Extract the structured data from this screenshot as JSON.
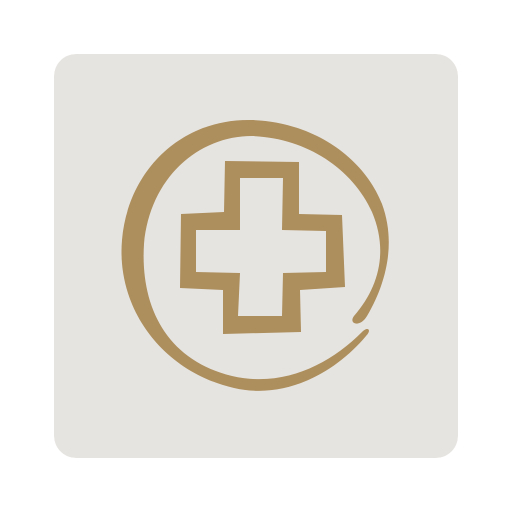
{
  "icon": {
    "name": "medical-cross-app-icon",
    "motif": "circled-plus-outline",
    "colors": {
      "tile_background": "#e6e4e0",
      "emblem": "#ad8e5d",
      "page_background": "#ffffff"
    }
  }
}
